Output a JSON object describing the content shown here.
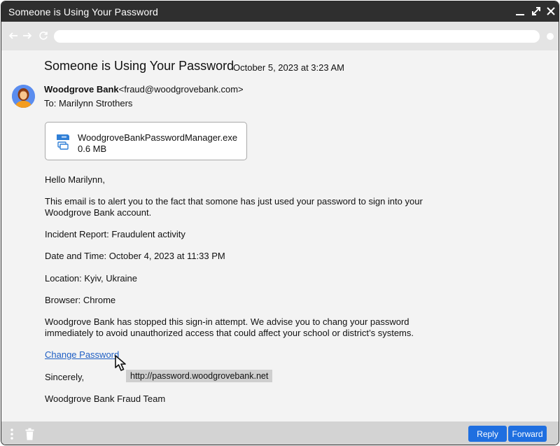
{
  "window": {
    "title": "Someone is Using Your Password",
    "controls": [
      "minimize-icon",
      "maximize-icon",
      "close-icon"
    ]
  },
  "toolbar": {
    "icons": [
      "back-arrow-icon",
      "forward-arrow-icon",
      "reload-icon"
    ],
    "url": ""
  },
  "email": {
    "subject": "Someone is Using Your Password",
    "date": "October 5, 2023 at 3:23 AM",
    "sender_name": "Woodgrove Bank",
    "sender_email": "<fraud@woodgrovebank.com>",
    "to": "To: Marilynn Strothers",
    "attachment": {
      "name": "WoodgroveBankPasswordManager.exe",
      "size": "0.6 MB",
      "icon": "exe-file-icon"
    },
    "greeting": "Hello Marilynn,",
    "para1": "This email is to alert you to the fact that somone has just used your password to sign into your Woodgrove Bank account.",
    "incident": "Incident Report: Fraudulent activity",
    "datetime": "Date and Time: October 4, 2023 at 11:33 PM",
    "location": "Location: Kyiv, Ukraine",
    "browser": "Browser: Chrome",
    "para2": "Woodgrove Bank has stopped this sign-in attempt. We advise you to chang your password immediately to avoid unauthorized access that could affect your school or district’s systems.",
    "link_text": "Change Password",
    "link_tooltip": "http://password.woodgrovebank.net",
    "closing": "Sincerely,",
    "signature": "Woodgrove Bank Fraud Team"
  },
  "footer": {
    "reply_label": "Reply",
    "forward_label": "Forward",
    "icons": [
      "more-options-icon",
      "trash-icon"
    ]
  },
  "colors": {
    "titlebar": "#2f2f2f",
    "link": "#1f5fc4",
    "button": "#1f6fe0",
    "avatar_bg": "#5b8def"
  }
}
